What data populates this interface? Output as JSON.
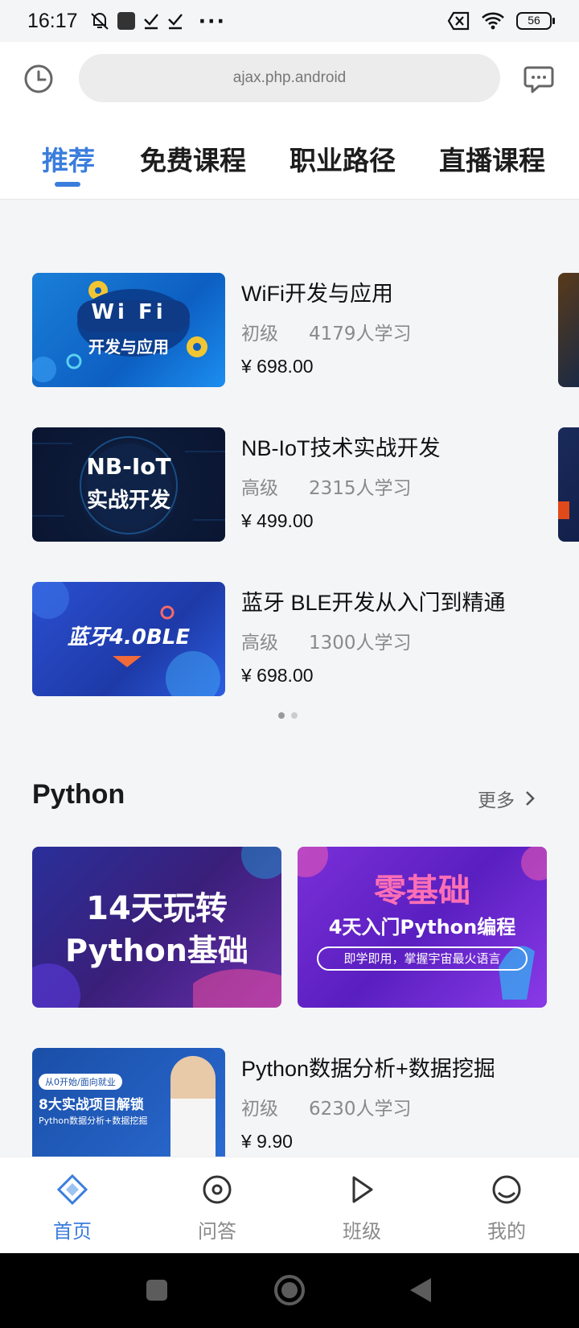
{
  "status_bar": {
    "time": "16:17",
    "battery": "56",
    "more": "···"
  },
  "search": {
    "placeholder": "ajax.php.android"
  },
  "tabs": [
    {
      "label": "推荐",
      "active": true
    },
    {
      "label": "免费课程",
      "active": false
    },
    {
      "label": "职业路径",
      "active": false
    },
    {
      "label": "直播课程",
      "active": false
    }
  ],
  "featured_courses": [
    {
      "title": "WiFi开发与应用",
      "level": "初级",
      "learners": "4179人学习",
      "price": "¥ 698.00",
      "thumb_text": [
        "Wi Fi",
        "开发与应用"
      ]
    },
    {
      "title": "NB-IoT技术实战开发",
      "level": "高级",
      "learners": "2315人学习",
      "price": "¥ 499.00",
      "thumb_text": [
        "NB-IoT",
        "实战开发"
      ]
    },
    {
      "title": "蓝牙 BLE开发从入门到精通",
      "level": "高级",
      "learners": "1300人学习",
      "price": "¥ 698.00",
      "thumb_text": [
        "蓝牙4.0BLE"
      ]
    }
  ],
  "python_section": {
    "title": "Python",
    "more_label": "更多",
    "banners": [
      {
        "line1": "14天玩转",
        "line2": "Python基础"
      },
      {
        "line1": "零基础",
        "line2": "4天入门Python编程",
        "line3": "即学即用，掌握宇宙最火语言"
      }
    ],
    "course": {
      "title": "Python数据分析+数据挖掘",
      "level": "初级",
      "learners": "6230人学习",
      "price": "¥ 9.90",
      "thumb_text": [
        "从0开始/面向就业",
        "8大实战项目解锁",
        "Python数据分析+数据挖掘"
      ]
    }
  },
  "bottom_nav": [
    {
      "label": "首页",
      "icon": "home-diamond-icon",
      "active": true
    },
    {
      "label": "问答",
      "icon": "qa-circle-icon",
      "active": false
    },
    {
      "label": "班级",
      "icon": "play-icon",
      "active": false
    },
    {
      "label": "我的",
      "icon": "profile-icon",
      "active": false
    }
  ],
  "colors": {
    "accent": "#3b7ddd",
    "price": "#111111",
    "meta": "#8a8a8a"
  }
}
